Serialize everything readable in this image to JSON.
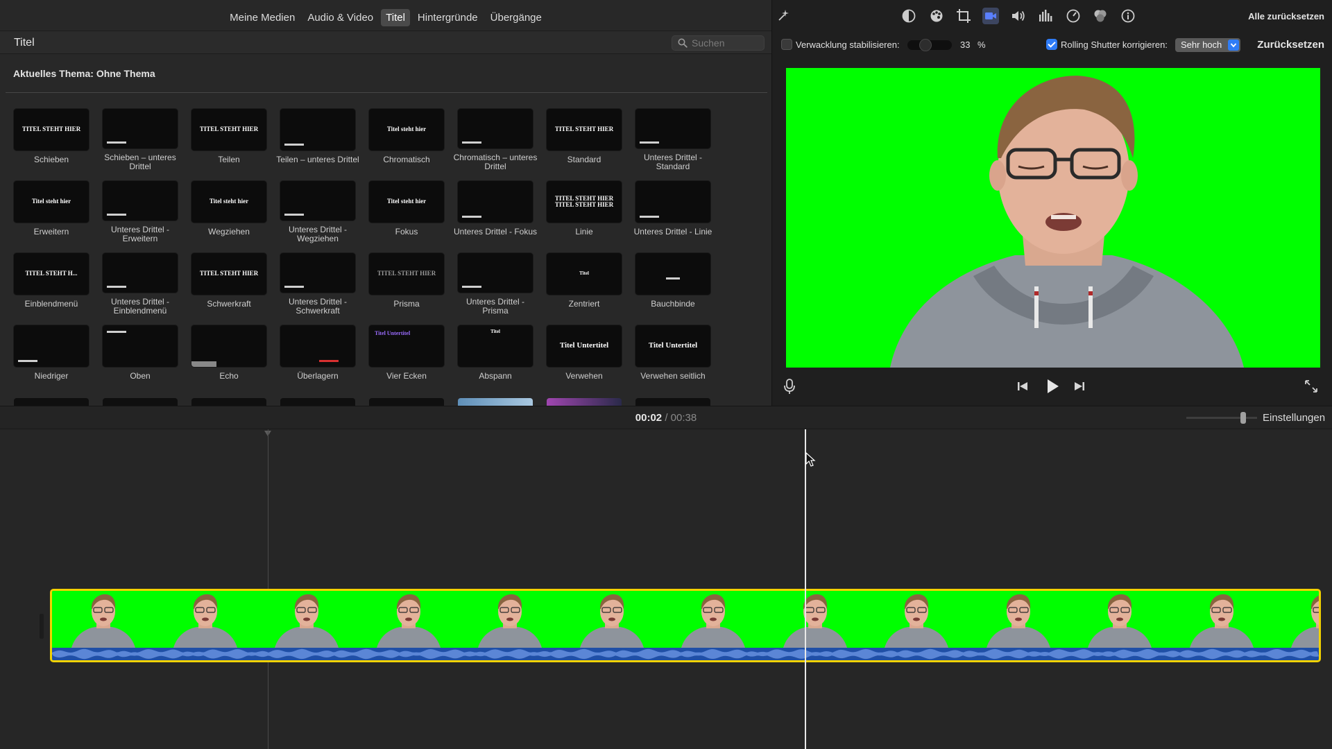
{
  "browser": {
    "tabs": [
      {
        "label": "Meine Medien",
        "active": false
      },
      {
        "label": "Audio & Video",
        "active": false
      },
      {
        "label": "Titel",
        "active": true
      },
      {
        "label": "Hintergründe",
        "active": false
      },
      {
        "label": "Übergänge",
        "active": false
      }
    ],
    "section_title": "Titel",
    "search_placeholder": "Suchen",
    "theme_label": "Aktuelles Thema: Ohne Thema",
    "titles": [
      {
        "label": "Schieben",
        "thumb": "TITEL STEHT HIER"
      },
      {
        "label": "Schieben – unteres Drittel",
        "thumb": ""
      },
      {
        "label": "Teilen",
        "thumb": "TITEL STEHT HIER"
      },
      {
        "label": "Teilen – unteres Drittel",
        "thumb": ""
      },
      {
        "label": "Chromatisch",
        "thumb": "Titel steht hier"
      },
      {
        "label": "Chromatisch – unteres Drittel",
        "thumb": ""
      },
      {
        "label": "Standard",
        "thumb": "TITEL STEHT HIER"
      },
      {
        "label": "Unteres Drittel - Standard",
        "thumb": ""
      },
      {
        "label": "Erweitern",
        "thumb": "Titel steht hier"
      },
      {
        "label": "Unteres Drittel - Erweitern",
        "thumb": ""
      },
      {
        "label": "Wegziehen",
        "thumb": "Titel steht hier"
      },
      {
        "label": "Unteres Drittel - Wegziehen",
        "thumb": ""
      },
      {
        "label": "Fokus",
        "thumb": "Titel steht hier"
      },
      {
        "label": "Unteres Drittel - Fokus",
        "thumb": ""
      },
      {
        "label": "Linie",
        "thumb": "TITEL STEHT HIER TITEL STEHT HIER"
      },
      {
        "label": "Unteres Drittel - Linie",
        "thumb": ""
      },
      {
        "label": "Einblendmenü",
        "thumb": "TITEL STEHT H..."
      },
      {
        "label": "Unteres Drittel - Einblendmenü",
        "thumb": ""
      },
      {
        "label": "Schwerkraft",
        "thumb": "TITEL STEHT HIER"
      },
      {
        "label": "Unteres Drittel - Schwerkraft",
        "thumb": ""
      },
      {
        "label": "Prisma",
        "thumb": "TITEL STEHT HIER"
      },
      {
        "label": "Unteres Drittel - Prisma",
        "thumb": ""
      },
      {
        "label": "Zentriert",
        "thumb": "Titel"
      },
      {
        "label": "Bauchbinde",
        "thumb": ""
      },
      {
        "label": "Niedriger",
        "thumb": ""
      },
      {
        "label": "Oben",
        "thumb": ""
      },
      {
        "label": "Echo",
        "thumb": ""
      },
      {
        "label": "Überlagern",
        "thumb": ""
      },
      {
        "label": "Vier Ecken",
        "thumb": "Titel Untertitel"
      },
      {
        "label": "Abspann",
        "thumb": "Titel"
      },
      {
        "label": "Verwehen",
        "thumb": "Titel Untertitel"
      },
      {
        "label": "Verwehen seitlich",
        "thumb": "Titel Untertitel"
      }
    ]
  },
  "viewer": {
    "reset_all_label": "Alle zurücksetzen",
    "stabilize_label": "Verwacklung stabilisieren:",
    "stabilize_checked": false,
    "stabilize_value": "33",
    "stabilize_unit": "%",
    "rolling_shutter_label": "Rolling Shutter korrigieren:",
    "rolling_shutter_checked": true,
    "rolling_shutter_value": "Sehr hoch",
    "reset_label": "Zurücksetzen",
    "tools": [
      "magic-wand-icon",
      "color-balance-icon",
      "color-palette-icon",
      "crop-icon",
      "stabilization-camera-icon",
      "volume-icon",
      "equalizer-icon",
      "speed-icon",
      "clip-filter-icon",
      "info-icon"
    ],
    "active_tool": "stabilization-camera-icon",
    "colors": {
      "accent": "#2f7cf6",
      "green_screen": "#00ff00",
      "clip_border": "#f2d200",
      "audio_wave": "#1f4fa6"
    }
  },
  "timeline": {
    "current_time": "00:02",
    "separator": "/",
    "total_time": "00:38",
    "settings_label": "Einstellungen"
  }
}
